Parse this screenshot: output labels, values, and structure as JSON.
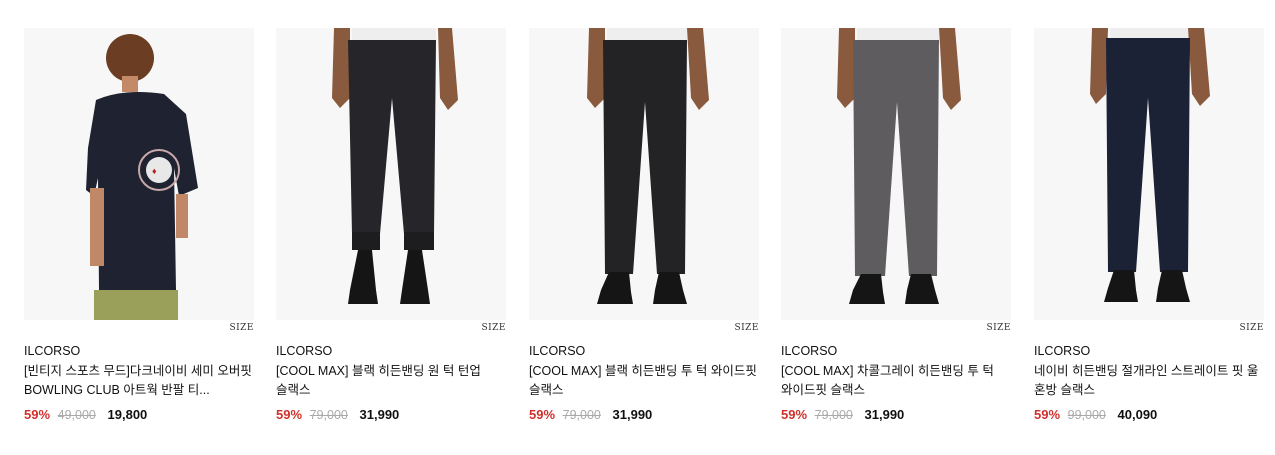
{
  "products": [
    {
      "image": "navy-bowling-tshirt-back-view",
      "size_label": "SIZE",
      "brand": "ILCORSO",
      "title": "[빈티지 스포츠 무드]다크네이비 세미 오버핏 BOWLING CLUB 아트웍 반팔 티...",
      "discount": "59%",
      "original_price": "49,000",
      "sale_price": "19,800",
      "colors": {
        "garment": "#1e2231",
        "bg": "#f7f7f7"
      }
    },
    {
      "image": "black-cuffed-slacks",
      "size_label": "SIZE",
      "brand": "ILCORSO",
      "title": "[COOL MAX] 블랙 히든밴딩 원 턱 턴업 슬랙스",
      "discount": "59%",
      "original_price": "79,000",
      "sale_price": "31,990",
      "colors": {
        "garment": "#26262a",
        "bg": "#f7f7f7"
      }
    },
    {
      "image": "black-two-tuck-wide-slacks",
      "size_label": "SIZE",
      "brand": "ILCORSO",
      "title": "[COOL MAX] 블랙 히든밴딩 투 턱 와이드핏 슬랙스",
      "discount": "59%",
      "original_price": "79,000",
      "sale_price": "31,990",
      "colors": {
        "garment": "#232325",
        "bg": "#f7f7f7"
      }
    },
    {
      "image": "charcoal-gray-two-tuck-wide-slacks",
      "size_label": "SIZE",
      "brand": "ILCORSO",
      "title": "[COOL MAX] 차콜그레이 히든밴딩 투 턱 와이드핏 슬랙스",
      "discount": "59%",
      "original_price": "79,000",
      "sale_price": "31,990",
      "colors": {
        "garment": "#5e5c5f",
        "bg": "#f7f7f7"
      }
    },
    {
      "image": "navy-straight-slacks",
      "size_label": "SIZE",
      "brand": "ILCORSO",
      "title": "네이비 히든밴딩 절개라인 스트레이트 핏 울 혼방 슬랙스",
      "discount": "59%",
      "original_price": "99,000",
      "sale_price": "40,090",
      "colors": {
        "garment": "#1c2236",
        "bg": "#f7f7f7"
      }
    }
  ],
  "colors": {
    "discount": "#d0312d",
    "original_price": "#aaaaaa",
    "skin": "#8a5a3e",
    "shoe": "#151515",
    "shirt_white": "#eeeeee"
  }
}
